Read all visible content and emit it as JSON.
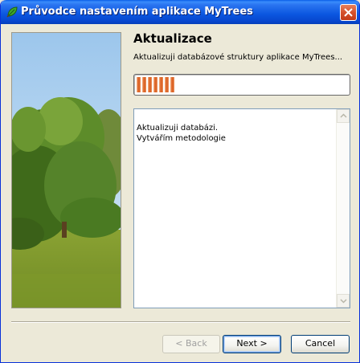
{
  "window": {
    "title": "Průvodce nastavením aplikace MyTrees",
    "accent": "#0a56e0"
  },
  "page": {
    "heading": "Aktualizace",
    "subtext": "Aktualizuji databázové struktury aplikace MyTrees..."
  },
  "progress": {
    "segments_filled": 7,
    "fill_color": "#d85a1c"
  },
  "log": {
    "lines": [
      "Aktualizuji databázi.",
      "Vytvářím metodologie"
    ]
  },
  "buttons": {
    "back": "< Back",
    "next": "Next >",
    "cancel": "Cancel"
  },
  "icons": {
    "app": "tree-leaf-icon",
    "close": "close-icon",
    "scroll_up": "chevron-up-icon",
    "scroll_down": "chevron-down-icon"
  }
}
